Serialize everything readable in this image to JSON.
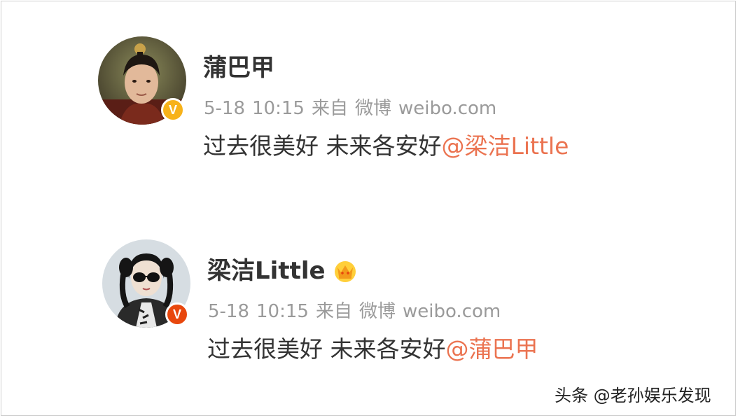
{
  "posts": [
    {
      "username": "蒲巴甲",
      "verified_badge": "V",
      "badge_color": "#f7b21a",
      "date": "5-18",
      "time": "10:15",
      "source_prefix": "来自",
      "source_name": "微博",
      "source_domain": "weibo.com",
      "text": "过去很美好 未来各安好",
      "mention": "@梁洁Little"
    },
    {
      "username": "梁洁Little",
      "verified_badge": "V",
      "badge_color": "#e8470d",
      "crown_icon": "crown-icon",
      "date": "5-18",
      "time": "10:15",
      "source_prefix": "来自",
      "source_name": "微博",
      "source_domain": "weibo.com",
      "text": "过去很美好 未来各安好",
      "mention": "@蒲巴甲"
    }
  ],
  "watermark": "头条 @老孙娱乐发现",
  "colors": {
    "mention": "#eb7350",
    "meta": "#9a9a9a",
    "text": "#333333"
  }
}
